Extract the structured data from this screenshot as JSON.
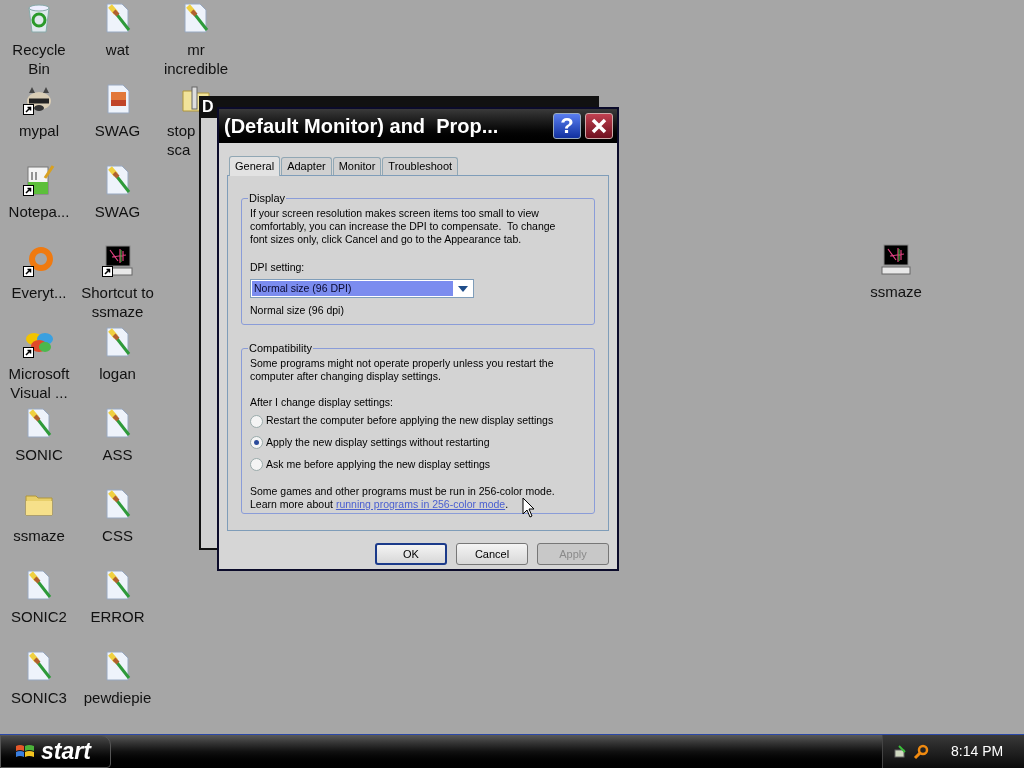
{
  "desktop": {
    "columns": [
      [
        {
          "label": "Recycle Bin",
          "kind": "recycle",
          "shortcut": false
        },
        {
          "label": "mypal",
          "kind": "raccoon",
          "shortcut": true
        },
        {
          "label": "Notepa...",
          "kind": "notepad",
          "shortcut": true
        },
        {
          "label": "Everyt...",
          "kind": "ring",
          "shortcut": true
        },
        {
          "label": "Microsoft Visual ...",
          "kind": "studio",
          "shortcut": true
        },
        {
          "label": "SONIC",
          "kind": "paint",
          "shortcut": false
        },
        {
          "label": "ssmaze",
          "kind": "folder",
          "shortcut": false
        },
        {
          "label": "SONIC2",
          "kind": "paint",
          "shortcut": false
        },
        {
          "label": "SONIC3",
          "kind": "paint",
          "shortcut": false
        }
      ],
      [
        {
          "label": "wat",
          "kind": "paint",
          "shortcut": false
        },
        {
          "label": "SWAG",
          "kind": "image",
          "shortcut": false
        },
        {
          "label": "SWAG",
          "kind": "paint",
          "shortcut": false
        },
        {
          "label": "Shortcut to ssmaze",
          "kind": "monitor",
          "shortcut": true
        },
        {
          "label": "logan",
          "kind": "paint",
          "shortcut": false
        },
        {
          "label": "ASS",
          "kind": "paint",
          "shortcut": false
        },
        {
          "label": "CSS",
          "kind": "paint",
          "shortcut": false
        },
        {
          "label": "ERROR",
          "kind": "paint",
          "shortcut": false
        },
        {
          "label": "pewdiepie",
          "kind": "paint",
          "shortcut": false
        }
      ],
      [
        {
          "label": "mr incredible",
          "kind": "paint",
          "shortcut": false
        },
        {
          "label": "stop sca",
          "kind": "zip",
          "shortcut": false,
          "clipped": true
        }
      ]
    ],
    "right_icons": [
      {
        "label": "ssmaze",
        "kind": "monitor",
        "shortcut": false
      }
    ]
  },
  "back_window": {
    "title": "D"
  },
  "dialog": {
    "title": "(Default Monitor) and  Prop...",
    "tabs": [
      {
        "label": "General",
        "selected": true
      },
      {
        "label": "Adapter",
        "selected": false
      },
      {
        "label": "Monitor",
        "selected": false
      },
      {
        "label": "Troubleshoot",
        "selected": false
      }
    ],
    "display": {
      "legend": "Display",
      "text": "If your screen resolution makes screen items too small to view\ncomfortably, you can increase the DPI to compensate.  To change\nfont sizes only, click Cancel and go to the Appearance tab.",
      "dpi_label": "DPI setting:",
      "dpi_value": "Normal size (96 DPI)",
      "dpi_note": "Normal size (96 dpi)"
    },
    "compatibility": {
      "legend": "Compatibility",
      "text": "Some programs might not operate properly unless you restart the\ncomputer after changing display settings.",
      "radio_label": "After I change display settings:",
      "options": [
        {
          "label": "Restart the computer before applying the new display settings",
          "selected": false
        },
        {
          "label": "Apply the new display settings without restarting",
          "selected": true
        },
        {
          "label": "Ask me before applying the new display settings",
          "selected": false
        }
      ],
      "note": "Some games and other programs must be run in 256-color mode.",
      "learn_prefix": "Learn more about",
      "link": "running programs in 256-color mode",
      "learn_suffix": "."
    },
    "buttons": [
      {
        "label": "OK",
        "disabled": false,
        "default": true
      },
      {
        "label": "Cancel",
        "disabled": false,
        "default": false
      },
      {
        "label": "Apply",
        "disabled": true,
        "default": false
      }
    ],
    "help_glyph": "?"
  },
  "taskbar": {
    "start": "start",
    "clock": "8:14 PM"
  }
}
